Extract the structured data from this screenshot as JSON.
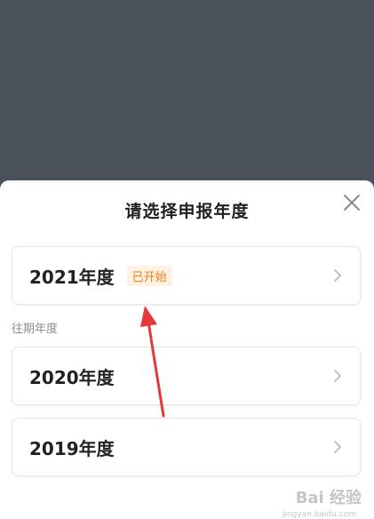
{
  "sheet": {
    "title": "请选择申报年度",
    "current": {
      "year": "2021年度",
      "badge": "已开始"
    },
    "past_label": "往期年度",
    "past": [
      {
        "year": "2020年度"
      },
      {
        "year": "2019年度"
      }
    ]
  },
  "watermark": {
    "text": "Bai 经验",
    "sub": "jingyan.baidu.com"
  },
  "colors": {
    "overlay": "#4a515b",
    "badge_text": "#f07d1a",
    "badge_bg": "#fff1e2",
    "arrow": "#e23a3a"
  },
  "icons": {
    "close": "close-icon",
    "chevron": "chevron-right-icon"
  }
}
